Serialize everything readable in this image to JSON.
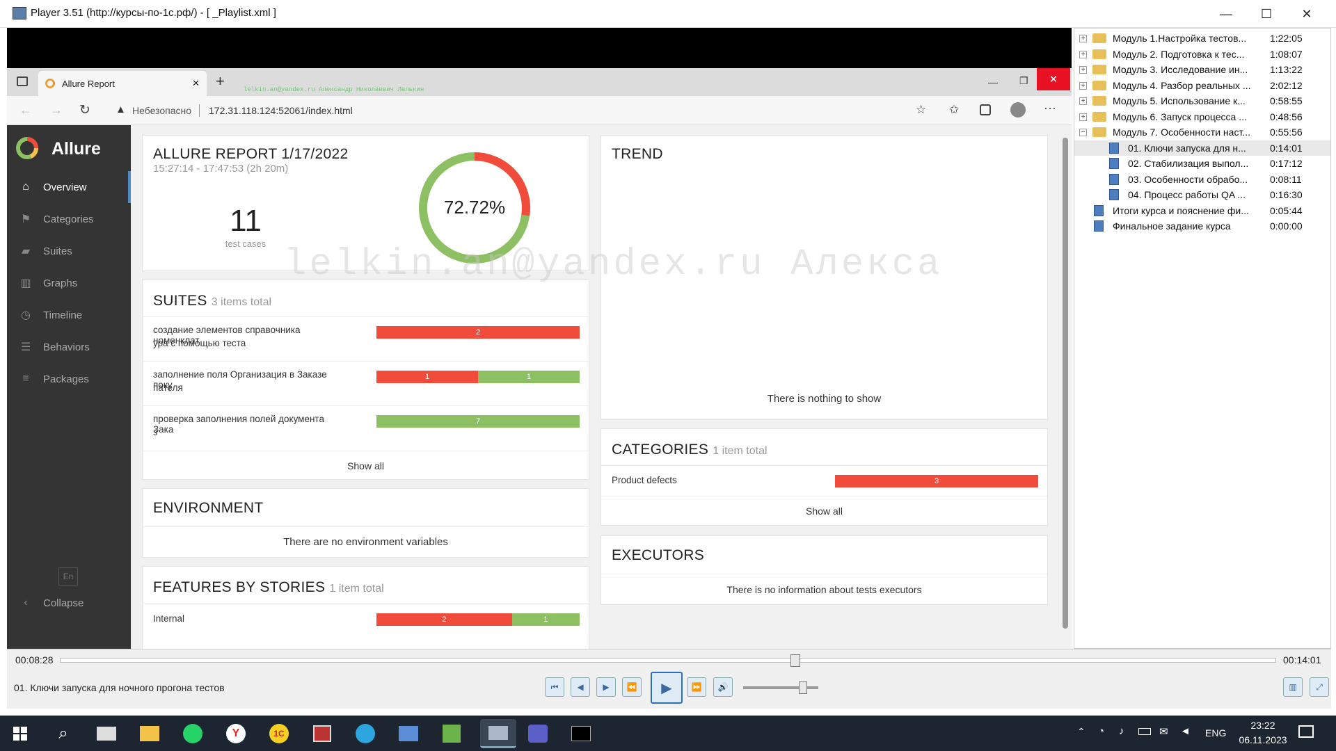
{
  "window": {
    "title": "Player 3.51 (http://курсы-по-1с.рф/) - [ _Playlist.xml ]",
    "minimize": "—",
    "maximize": "☐",
    "close": "✕"
  },
  "browser": {
    "tab_title": "Allure Report",
    "tab_close": "✕",
    "new_tab": "+",
    "security_label": "Небезопасно",
    "url": "172.31.118.124:52061/index.html",
    "watermark_small": "lelkin.an@yandex.ru Александр Николаевич Лелькин"
  },
  "sidebar": {
    "brand": "Allure",
    "items": [
      {
        "label": "Overview",
        "icon": "home-icon"
      },
      {
        "label": "Categories",
        "icon": "flag-icon"
      },
      {
        "label": "Suites",
        "icon": "briefcase-icon"
      },
      {
        "label": "Graphs",
        "icon": "bar-chart-icon"
      },
      {
        "label": "Timeline",
        "icon": "clock-icon"
      },
      {
        "label": "Behaviors",
        "icon": "list-icon"
      },
      {
        "label": "Packages",
        "icon": "align-left-icon"
      }
    ],
    "lang": "En",
    "collapse": "Collapse"
  },
  "report": {
    "title": "ALLURE REPORT 1/17/2022",
    "time": "15:27:14 - 17:47:53 (2h 20m)",
    "count": "11",
    "count_label": "test cases",
    "percent": "72.72%",
    "percent_value": 72.72
  },
  "suites": {
    "title": "SUITES",
    "subtitle": "3 items total",
    "rows": [
      {
        "name_line1": "создание элементов справочника номенклат",
        "name_line2": "ура с помощью теста",
        "failed": 2,
        "passed": 0,
        "failed_label": "2",
        "passed_label": ""
      },
      {
        "name_line1": "заполнение поля Организация в Заказе поку",
        "name_line2": "пателя",
        "failed": 1,
        "passed": 1,
        "failed_label": "1",
        "passed_label": "1"
      },
      {
        "name_line1": "проверка заполнения полей документа Зака",
        "name_line2": "з",
        "failed": 0,
        "passed": 7,
        "failed_label": "",
        "passed_label": "7"
      }
    ],
    "show_all": "Show all"
  },
  "environment": {
    "title": "ENVIRONMENT",
    "empty": "There are no environment variables"
  },
  "features": {
    "title": "FEATURES BY STORIES",
    "subtitle": "1 item total",
    "rows": [
      {
        "name": "Internal",
        "failed": 2,
        "passed": 1,
        "failed_label": "2",
        "passed_label": "1"
      }
    ]
  },
  "trend": {
    "title": "TREND",
    "empty": "There is nothing to show"
  },
  "categories": {
    "title": "CATEGORIES",
    "subtitle": "1 item total",
    "rows": [
      {
        "name": "Product defects",
        "value": 3,
        "label": "3"
      }
    ],
    "show_all": "Show all"
  },
  "executors": {
    "title": "EXECUTORS",
    "empty": "There is no information about tests executors"
  },
  "watermark": "lelkin.an@yandex.ru Алекса",
  "playlist": {
    "items": [
      {
        "name": "Модуль 1.Настройка тестов...",
        "time": "1:22:05",
        "type": "folder",
        "level": 0,
        "expander": "+"
      },
      {
        "name": "Модуль 2. Подготовка к тес...",
        "time": "1:08:07",
        "type": "folder",
        "level": 0,
        "expander": "+"
      },
      {
        "name": "Модуль 3. Исследование ин...",
        "time": "1:13:22",
        "type": "folder",
        "level": 0,
        "expander": "+"
      },
      {
        "name": "Модуль 4. Разбор реальных ...",
        "time": "2:02:12",
        "type": "folder",
        "level": 0,
        "expander": "+"
      },
      {
        "name": "Модуль 5. Использование к...",
        "time": "0:58:55",
        "type": "folder",
        "level": 0,
        "expander": "+"
      },
      {
        "name": "Модуль 6. Запуск процесса ...",
        "time": "0:48:56",
        "type": "folder",
        "level": 0,
        "expander": "+"
      },
      {
        "name": "Модуль 7. Особенности наст...",
        "time": "0:55:56",
        "type": "folder",
        "level": 0,
        "expander": "−"
      },
      {
        "name": "01. Ключи запуска для н...",
        "time": "0:14:01",
        "type": "video",
        "level": 1,
        "selected": true
      },
      {
        "name": "02. Стабилизация выпол...",
        "time": "0:17:12",
        "type": "video",
        "level": 1
      },
      {
        "name": "03. Особенности обрабо...",
        "time": "0:08:11",
        "type": "video",
        "level": 1
      },
      {
        "name": "04. Процесс работы QA ...",
        "time": "0:16:30",
        "type": "video",
        "level": 1
      },
      {
        "name": "Итоги курса и пояснение фи...",
        "time": "0:05:44",
        "type": "video",
        "level": 0
      },
      {
        "name": "Финальное задание курса",
        "time": "0:00:00",
        "type": "video",
        "level": 0
      }
    ]
  },
  "player": {
    "current_time": "00:08:28",
    "total_time": "00:14:01",
    "progress": 0.604,
    "volume": 0.8,
    "now_playing": "01. Ключи запуска для ночного прогона тестов"
  },
  "taskbar": {
    "time": "23:22",
    "date": "06.11.2023",
    "lang": "ENG"
  },
  "colors": {
    "failed": "#f04b3b",
    "passed": "#8cc063",
    "sidebar": "#343434"
  }
}
